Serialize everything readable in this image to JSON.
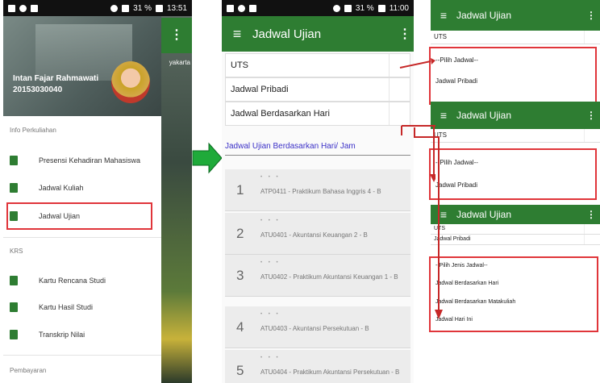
{
  "phone1": {
    "status": {
      "battery": "31 %",
      "time": "13:51"
    },
    "bg_text": "yakarta",
    "bg_menu": "⋮",
    "user": {
      "name": "Intan Fajar Rahmawati",
      "id": "20153030040"
    },
    "sections": {
      "info": "Info Perkuliahan",
      "krs": "KRS",
      "bayar": "Pembayaran"
    },
    "items": [
      {
        "label": "Presensi Kehadiran Mahasiswa"
      },
      {
        "label": "Jadwal Kuliah"
      },
      {
        "label": "Jadwal Ujian"
      },
      {
        "label": "Kartu Rencana Studi"
      },
      {
        "label": "Kartu Hasil Studi"
      },
      {
        "label": "Transkrip Nilai"
      }
    ]
  },
  "phone2": {
    "status": {
      "battery": "31 %",
      "time": "11:00"
    },
    "title": "Jadwal Ujian",
    "menu_icon": "≡",
    "dots": "⋮",
    "spinner_values": [
      "UTS",
      "Jadwal Pribadi",
      "Jadwal Berdasarkan Hari"
    ],
    "link": "Jadwal Ujian Berdasarkan Hari/ Jam",
    "cards": [
      {
        "num": "1",
        "text": "ATP0411 - Praktikum Bahasa Inggris 4 - B"
      },
      {
        "num": "2",
        "text": "ATU0401 - Akuntansi Keuangan 2 - B"
      },
      {
        "num": "3",
        "text": "ATU0402 - Praktikum Akuntansi Keuangan 1 - B"
      },
      {
        "num": "4",
        "text": "ATU0403 - Akuntansi Persekutuan - B"
      },
      {
        "num": "5",
        "text": "ATU0404 - Praktikum Akuntansi Persekutuan - B"
      }
    ],
    "card_dots": "• • •"
  },
  "panel1": {
    "title": "Jadwal Ujian",
    "spinner": "UTS",
    "options": [
      "--Pilih Jadwal--",
      "Jadwal Pribadi"
    ]
  },
  "panel2": {
    "title": "Jadwal Ujian",
    "spinner": "UTS",
    "options": [
      "--Pilih Jadwal--",
      "Jadwal Pribadi"
    ]
  },
  "panel3": {
    "title": "Jadwal Ujian",
    "spinners": [
      "UTS",
      "Jadwal Pribadi"
    ],
    "options": [
      "--Pilih Jenis Jadwal--",
      "Jadwal Berdasarkan Hari",
      "Jadwal Berdasarkan Matakuliah",
      "Jadwal Hari Ini"
    ]
  },
  "colors": {
    "appbar": "#2e7d32",
    "highlight": "#e0353a",
    "arrow_green": "#1faa3a",
    "link": "#3b30c7"
  }
}
